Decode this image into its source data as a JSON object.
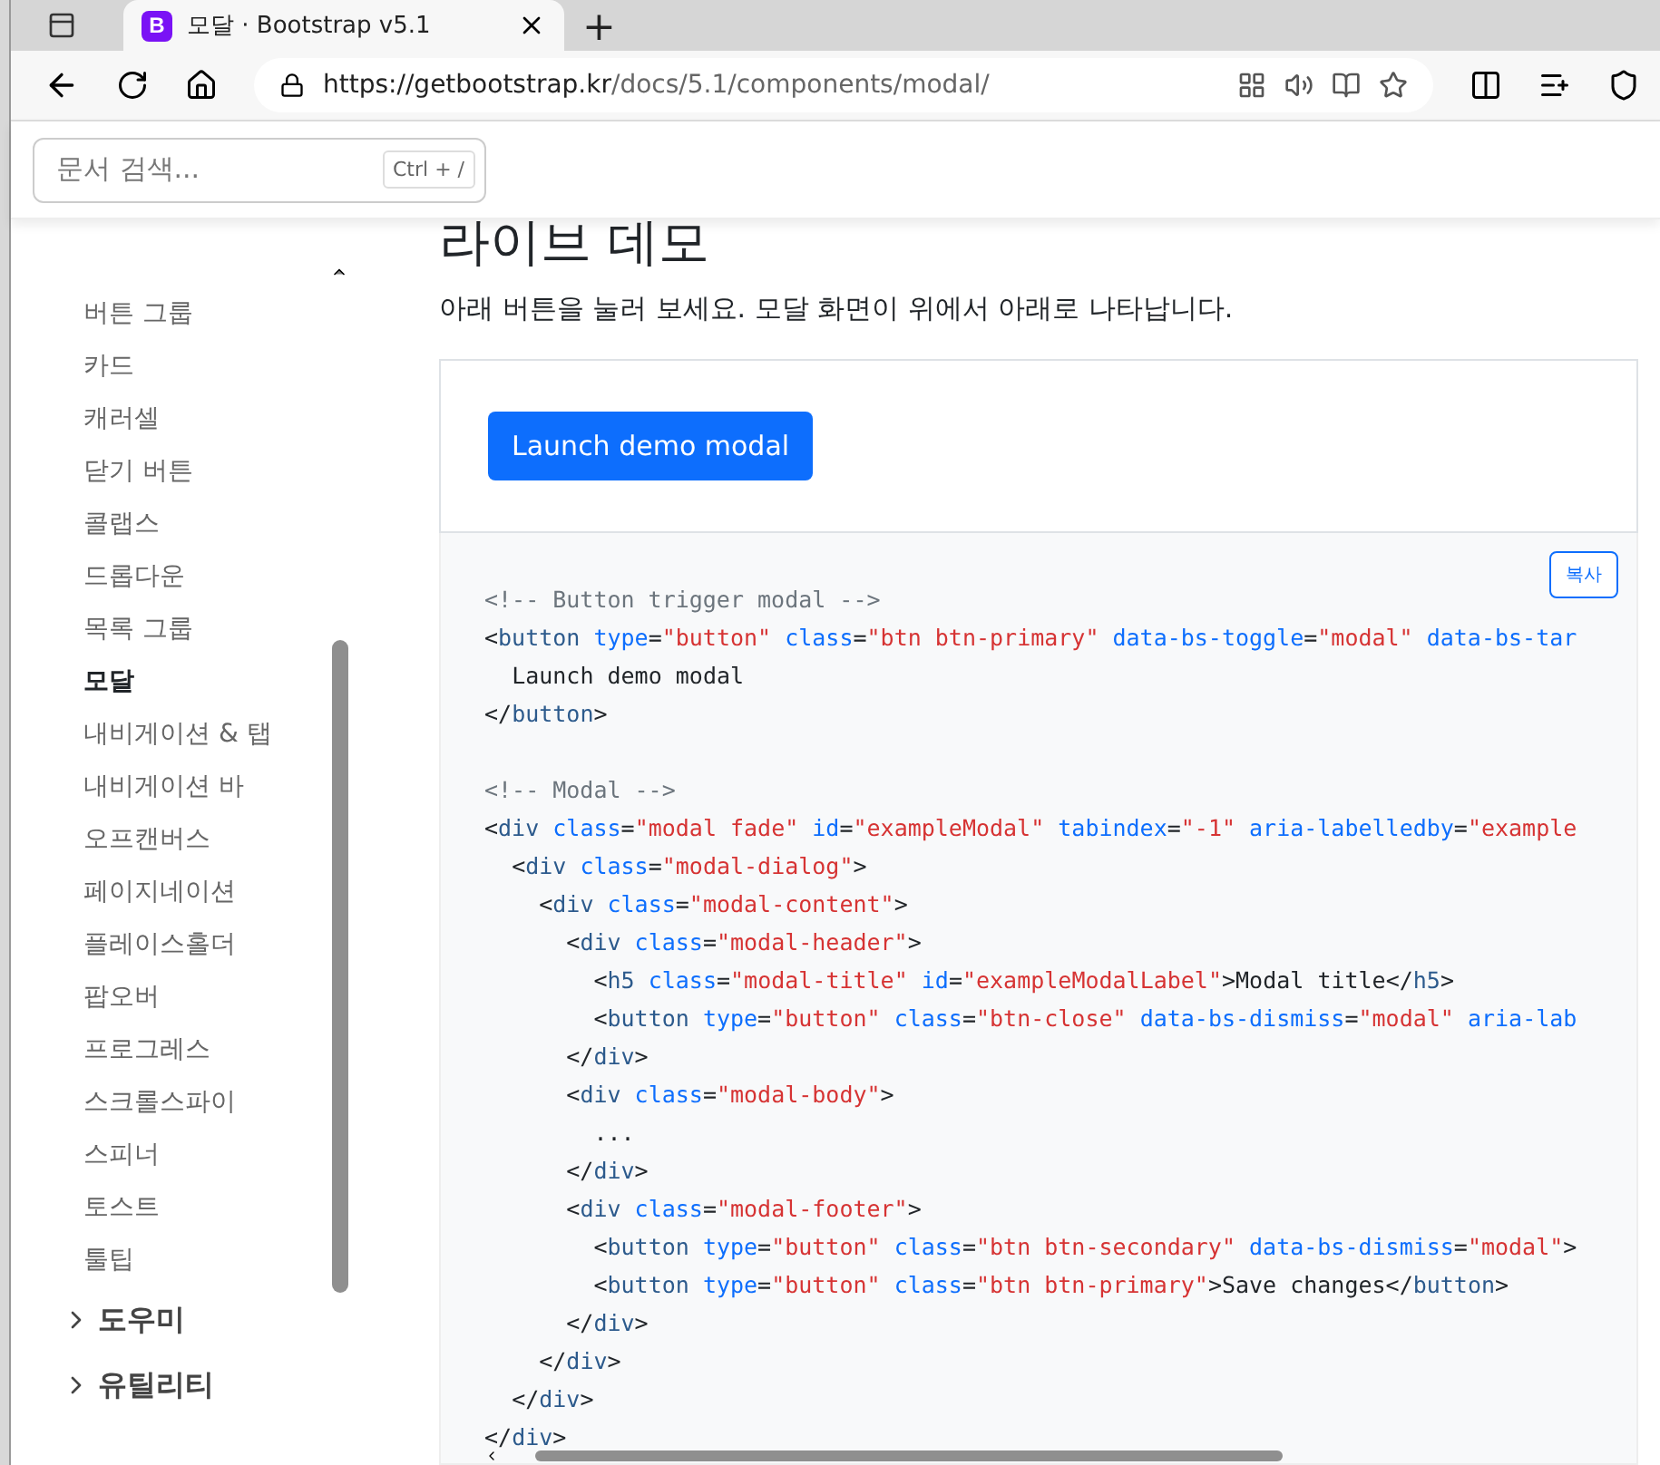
{
  "browser": {
    "tab": {
      "logo": "B",
      "title": "모달 · Bootstrap v5.1",
      "selected": true
    },
    "new_tab": "+",
    "url": {
      "host": "https://getbootstrap.kr",
      "path": "/docs/5.1/components/modal/"
    }
  },
  "search": {
    "placeholder": "문서 검색...",
    "shortcut": "Ctrl + /"
  },
  "sidebar": {
    "items": [
      {
        "label": "버튼 그룹",
        "selected": false
      },
      {
        "label": "카드",
        "selected": false
      },
      {
        "label": "캐러셀",
        "selected": false
      },
      {
        "label": "닫기 버튼",
        "selected": false
      },
      {
        "label": "콜랩스",
        "selected": false
      },
      {
        "label": "드롭다운",
        "selected": false
      },
      {
        "label": "목록 그룹",
        "selected": false
      },
      {
        "label": "모달",
        "selected": true
      },
      {
        "label": "내비게이션 & 탭",
        "selected": false
      },
      {
        "label": "내비게이션 바",
        "selected": false
      },
      {
        "label": "오프캔버스",
        "selected": false
      },
      {
        "label": "페이지네이션",
        "selected": false
      },
      {
        "label": "플레이스홀더",
        "selected": false
      },
      {
        "label": "팝오버",
        "selected": false
      },
      {
        "label": "프로그레스",
        "selected": false
      },
      {
        "label": "스크롤스파이",
        "selected": false
      },
      {
        "label": "스피너",
        "selected": false
      },
      {
        "label": "토스트",
        "selected": false
      },
      {
        "label": "툴팁",
        "selected": false
      }
    ],
    "sections": [
      {
        "label": "도우미",
        "expanded": false
      },
      {
        "label": "유틸리티",
        "expanded": false
      }
    ]
  },
  "content": {
    "heading": "라이브 데모",
    "lead": "아래 버튼을 눌러 보세요. 모달 화면이 위에서 아래로 나타납니다.",
    "demo_button": "Launch demo modal",
    "copy_button": "복사",
    "code_blocks": [
      [
        "<!-- Button trigger modal -->",
        "<button type=\"button\" class=\"btn btn-primary\" data-bs-toggle=\"modal\" data-bs-tar",
        "  Launch demo modal",
        "</button>"
      ],
      [
        "<!-- Modal -->",
        "<div class=\"modal fade\" id=\"exampleModal\" tabindex=\"-1\" aria-labelledby=\"example",
        "  <div class=\"modal-dialog\">",
        "    <div class=\"modal-content\">",
        "      <div class=\"modal-header\">",
        "        <h5 class=\"modal-title\" id=\"exampleModalLabel\">Modal title</h5>",
        "        <button type=\"button\" class=\"btn-close\" data-bs-dismiss=\"modal\" aria-lab",
        "      </div>",
        "      <div class=\"modal-body\">",
        "        ...",
        "      </div>",
        "      <div class=\"modal-footer\">",
        "        <button type=\"button\" class=\"btn btn-secondary\" data-bs-dismiss=\"modal\">",
        "        <button type=\"button\" class=\"btn btn-primary\">Save changes</button>",
        "      </div>",
        "    </div>",
        "  </div>",
        "</div>"
      ]
    ]
  }
}
